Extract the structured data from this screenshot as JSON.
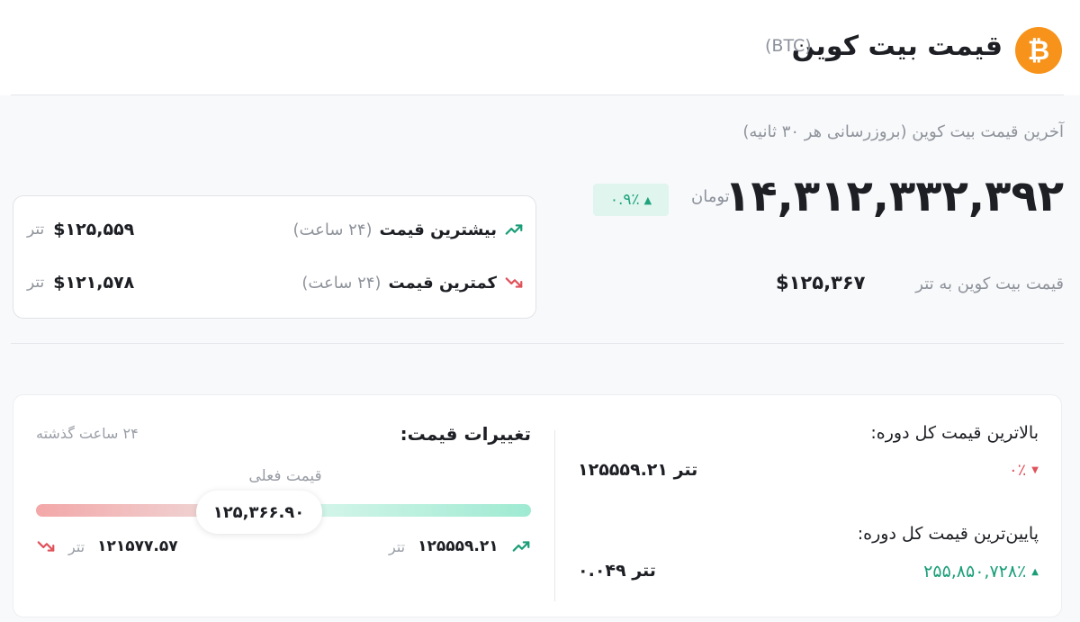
{
  "header": {
    "coin_symbol": "₿",
    "title": "قیمت بیت کوین",
    "ticker": "(BTC)"
  },
  "summary": {
    "update_note": "آخرین قیمت بیت کوین (بروزرسانی هر ۳۰ ثانیه)",
    "price_toman": "۱۴,۳۱۲,۳۳۲,۳۹۲",
    "toman_label": "تومان",
    "change_pct": "۰.۹٪",
    "change_dir": "up",
    "usdt_label": "قیمت بیت کوین به تتر",
    "usdt_value": "$۱۲۵,۳۶۷"
  },
  "stats_24h": {
    "high_label": "بیشترین قیمت",
    "high_period": "(۲۴ ساعت)",
    "high_value": "$۱۲۵,۵۵۹",
    "low_label": "کمترین قیمت",
    "low_period": "(۲۴ ساعت)",
    "low_value": "$۱۲۱,۵۷۸",
    "unit": "تتر"
  },
  "alltime": {
    "high_label": "بالاترین قیمت کل دوره:",
    "high_value": "۱۲۵۵۵۹.۲۱ تتر",
    "high_change": "۰٪",
    "low_label": "پایین‌ترین قیمت کل دوره:",
    "low_value": "۰.۰۴۹ تتر",
    "low_change": "۲۵۵,۸۵۰,۷۲۸٪"
  },
  "price_changes": {
    "title": "تغییرات قیمت:",
    "period": "۲۴ ساعت گذشته",
    "current_label": "قیمت فعلی",
    "current_value": "۱۲۵,۳۶۶.۹۰",
    "high_value": "۱۲۵۵۵۹.۲۱",
    "low_value": "۱۲۱۵۷۷.۵۷",
    "unit": "تتر",
    "current_position_fraction": 0.45
  },
  "colors": {
    "accent_up": "#1a9e78",
    "accent_down": "#e0525b",
    "bitcoin_orange": "#f7931a"
  }
}
